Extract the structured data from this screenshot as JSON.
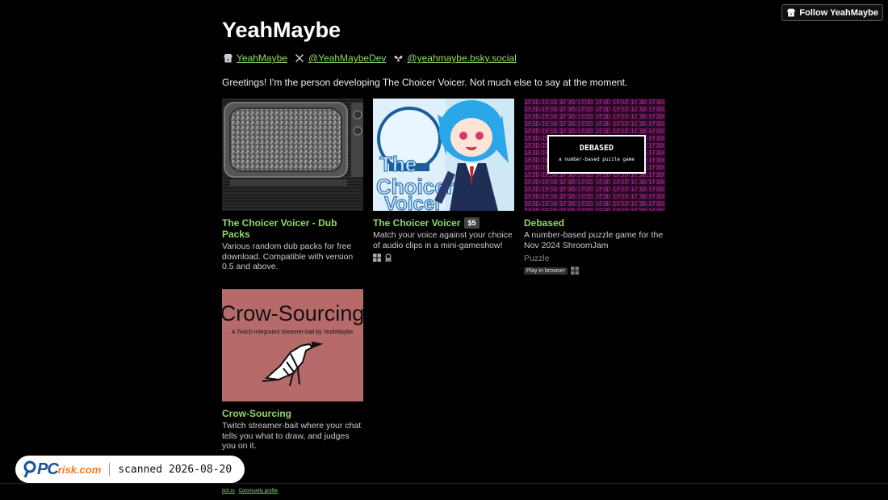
{
  "header": {
    "follow_label": "Follow YeahMaybe"
  },
  "profile": {
    "title": "YeahMaybe",
    "links": [
      {
        "icon": "itchio-icon",
        "label": "YeahMaybe"
      },
      {
        "icon": "x-icon",
        "label": "@YeahMaybeDev"
      },
      {
        "icon": "bluesky-icon",
        "label": "@yeahmaybe.bsky.social"
      }
    ],
    "bio": "Greetings! I'm the person developing The Choicer Voicer. Not much else to say at the moment."
  },
  "games": [
    {
      "title": "The Choicer Voicer - Dub Packs",
      "description": "Various random dub packs for free download. Compatible with version 0.5 and above.",
      "thumb": "tv-static"
    },
    {
      "title": "The Choicer Voicer",
      "price": "$5",
      "description": "Match your voice against your choice of audio clips in a mini-gameshow!",
      "platforms": [
        "windows-icon",
        "linux-icon"
      ],
      "thumb": "choicer-voicer"
    },
    {
      "title": "Debased",
      "description": "A number-based puzzle game for the Nov 2024 ShroomJam",
      "genre": "Puzzle",
      "badge": "Play in browser",
      "platforms": [
        "windows-icon"
      ],
      "thumb": "debased",
      "thumb_title": "DEBASED",
      "thumb_subtitle": "a number-based puzzle game"
    },
    {
      "title": "Crow-Sourcing",
      "description": "Twitch streamer-bait where your chat tells you what to draw, and judges you on it.",
      "thumb": "crow",
      "thumb_title": "Crow-Sourcing",
      "thumb_subtitle": "A Twitch-integrated streamer-bait by YeahMaybe"
    }
  ],
  "footer": {
    "links": [
      "itch.io",
      "Community profile"
    ]
  },
  "watermark": {
    "logo_pc": "PC",
    "logo_risk": "risk.com",
    "scan_text": "scanned 2026-08-20"
  },
  "colors": {
    "background": "#000000",
    "link": "#8fd86e",
    "debased_bg": "#3a0a2a",
    "crow_bg": "#b76a6a"
  }
}
